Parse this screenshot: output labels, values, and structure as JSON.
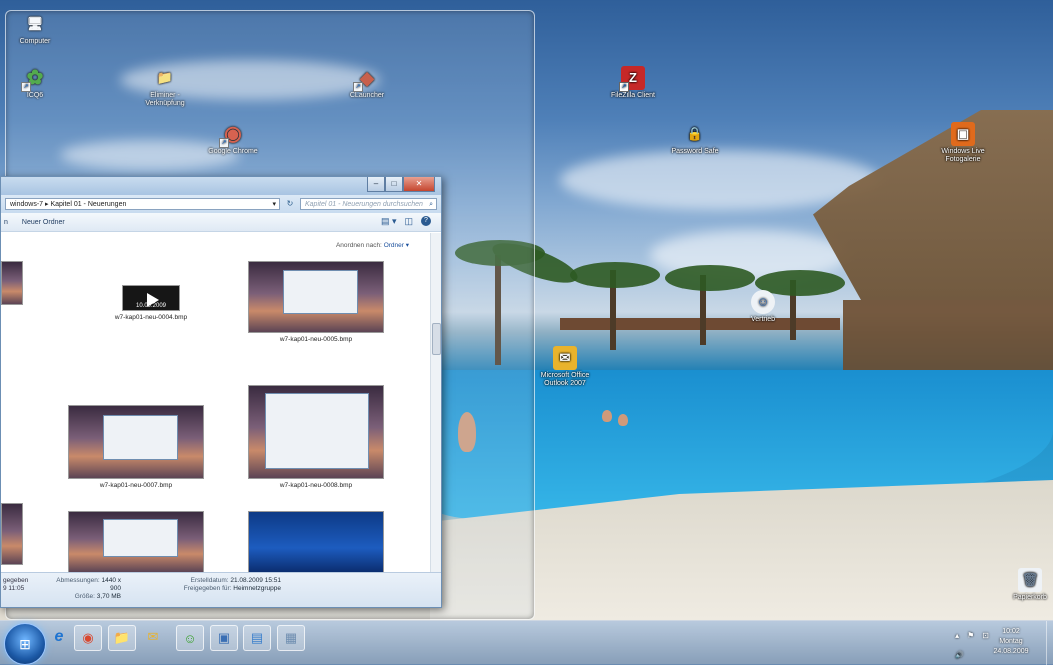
{
  "desktop": {
    "icons": [
      {
        "label": "Computer",
        "glyph": "🖥",
        "color": "#5577aa"
      },
      {
        "label": "ICQ6",
        "glyph": "✿",
        "color": "#3aa12c"
      },
      {
        "label": "Eliminer - Verknüpfung",
        "glyph": "📁",
        "color": "#e6c45a"
      },
      {
        "label": "Google Chrome",
        "glyph": "◉",
        "color": "#d9482f"
      },
      {
        "label": "CLauncher",
        "glyph": "◆",
        "color": "#c8462a"
      },
      {
        "label": "FileZilla Client",
        "glyph": "Z",
        "color": "#c62828"
      },
      {
        "label": "Password Safe",
        "glyph": "🔒",
        "color": "#e0b02a"
      },
      {
        "label": "Windows Live Fotogalerie",
        "glyph": "▣",
        "color": "#e06a1c"
      },
      {
        "label": "Vertrieb",
        "glyph": "☺",
        "color": "#3a6fb4"
      },
      {
        "label": "Microsoft Office Outlook 2007",
        "glyph": "✉",
        "color": "#e9b32c"
      },
      {
        "label": "Papierkorb",
        "glyph": "🗑",
        "color": "#90a4b8"
      }
    ]
  },
  "explorer": {
    "window_buttons": {
      "minimize": "–",
      "maximize": "□",
      "close": "✕"
    },
    "address": {
      "crumbs": "windows-7 ▸ Kapitel 01 - Neuerungen",
      "dropdown": "▾",
      "refresh": "↻"
    },
    "search": {
      "placeholder": "Kapitel 01 - Neuerungen durchsuchen",
      "icon": "⌕"
    },
    "toolbar": {
      "partial_item": "n",
      "new_folder": "Neuer Ordner",
      "view_icon": "▤ ▾",
      "pane_icon": "◫",
      "help_icon": "?"
    },
    "arrange": {
      "label": "Anordnen nach:",
      "value": "Ordner ▾"
    },
    "files": [
      {
        "name": "w7-kap01-neu-0004.bmp",
        "kind": "video",
        "overlay_date": "10.09.2009"
      },
      {
        "name": "w7-kap01-neu-0005.bmp",
        "kind": "desktop"
      },
      {
        "name": "w7-kap01-neu-0007.bmp",
        "kind": "desktop"
      },
      {
        "name": "w7-kap01-neu-0008.bmp",
        "kind": "desktop"
      },
      {
        "name": "",
        "kind": "desktop"
      },
      {
        "name": "",
        "kind": "blue"
      }
    ],
    "details": {
      "left_partial": [
        "gegeben",
        "9 11:05"
      ],
      "dimensions_label": "Abmessungen:",
      "dimensions_value": "1440 x 900",
      "size_label": "Größe:",
      "size_value": "3,70 MB",
      "created_label": "Erstelldatum:",
      "created_value": "21.08.2009 15:51",
      "shared_label": "Freigegeben für:",
      "shared_value": "Heimnetzgruppe"
    }
  },
  "taskbar": {
    "start_glyph": "⊞",
    "apps": [
      {
        "name": "Internet Explorer",
        "glyph": "e",
        "color": "#1f74d1"
      },
      {
        "name": "Google Chrome",
        "glyph": "◉",
        "color": "#d9482f"
      },
      {
        "name": "Explorer",
        "glyph": "📁",
        "color": "#e6c45a"
      },
      {
        "name": "Outlook",
        "glyph": "✉",
        "color": "#e9b32c"
      },
      {
        "name": "ICQ",
        "glyph": "☺",
        "color": "#3aa12c"
      },
      {
        "name": "Notes",
        "glyph": "▣",
        "color": "#3a6fb4"
      },
      {
        "name": "Messenger",
        "glyph": "▤",
        "color": "#3a7fcc"
      },
      {
        "name": "Document",
        "glyph": "▦",
        "color": "#6f8eb0"
      }
    ],
    "tray": {
      "icons": [
        "▴",
        "⚑",
        "⊡",
        "🔊"
      ],
      "time": "10:02",
      "day": "Montag",
      "date": "24.08.2009"
    }
  }
}
